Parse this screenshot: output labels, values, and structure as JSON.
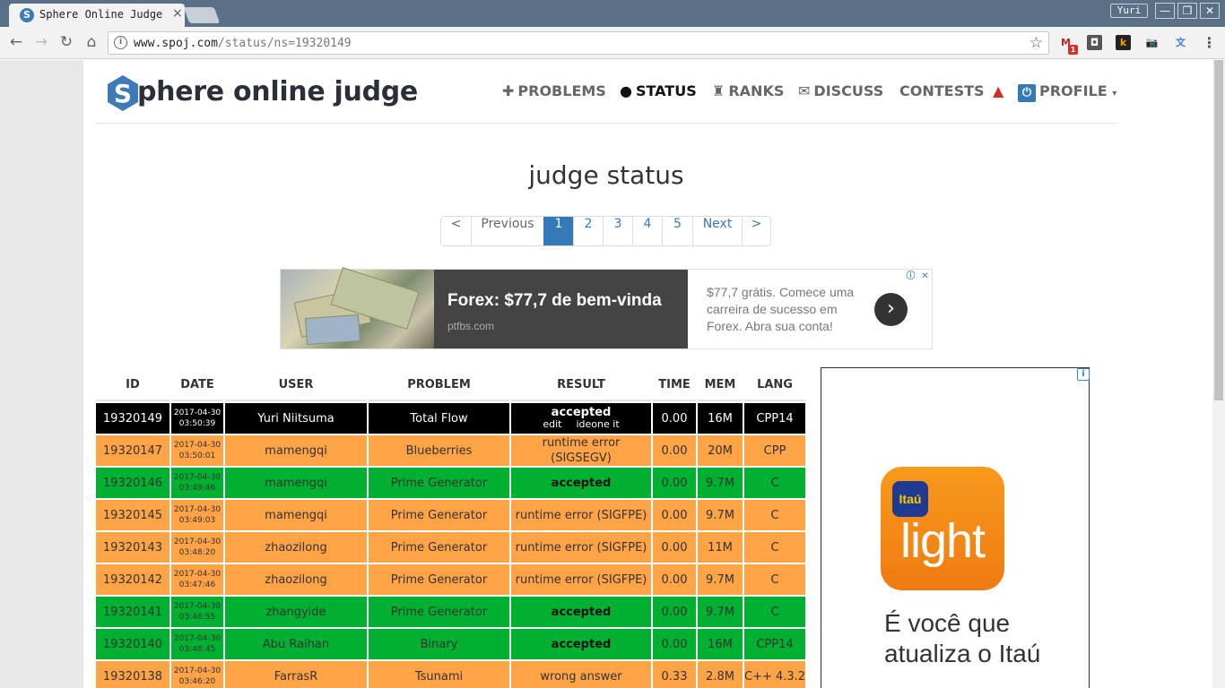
{
  "browser": {
    "tab_title": "Sphere Online Judge",
    "favicon_letter": "S",
    "tab_close": "×",
    "user_label": "Yuri",
    "url_host": "www.spoj.com",
    "url_path": "/status/ns=19320149",
    "nav": {
      "back": "←",
      "forward": "→",
      "reload": "↻",
      "home": "⌂"
    },
    "window_buttons": [
      "—",
      "❐",
      "✕"
    ],
    "extensions": [
      {
        "name": "gmail-icon",
        "glyph": "M",
        "badge": "1",
        "color": "#c5221f"
      },
      {
        "name": "pocket-icon",
        "glyph": "◘",
        "color": "#555"
      },
      {
        "name": "k-extension-icon",
        "glyph": "k",
        "color": "#f4a300"
      },
      {
        "name": "camera-icon",
        "glyph": "📷",
        "color": "#777"
      },
      {
        "name": "translate-icon",
        "glyph": "文",
        "color": "#3c78d8"
      },
      {
        "name": "menu-icon",
        "glyph": "⋮",
        "color": "#555"
      }
    ]
  },
  "site": {
    "logo_text": "phere online judge",
    "logo_letter": "S",
    "nav": {
      "problems": "PROBLEMS",
      "status": "STATUS",
      "ranks": "RANKS",
      "discuss": "DISCUSS",
      "contests": "CONTESTS",
      "profile": "PROFILE"
    }
  },
  "page_title": "judge status",
  "pagination": [
    "<",
    "Previous",
    "1",
    "2",
    "3",
    "4",
    "5",
    "Next",
    ">"
  ],
  "pagination_active": "1",
  "ad_banner": {
    "headline": "Forex: $77,7 de bem-vinda",
    "domain": "ptfbs.com",
    "body": "$77,7 grátis. Comece uma carreira de sucesso em Forex. Abra sua conta!",
    "arrow": "›",
    "info": "ⓘ",
    "close": "✕"
  },
  "table": {
    "headers": [
      "ID",
      "DATE",
      "USER",
      "PROBLEM",
      "RESULT",
      "TIME",
      "MEM",
      "LANG"
    ],
    "rows": [
      {
        "style": "black",
        "id": "19320149",
        "date": "2017-04-30",
        "time_of_day": "03:50:39",
        "user": "Yuri Niitsuma",
        "problem": "Total Flow",
        "result": "accepted",
        "result_links": [
          "edit",
          "ideone it"
        ],
        "time": "0.00",
        "mem": "16M",
        "lang": "CPP14"
      },
      {
        "style": "orange",
        "id": "19320147",
        "date": "2017-04-30",
        "time_of_day": "03:50:01",
        "user": "mamengqi",
        "problem": "Blueberries",
        "result": "runtime error",
        "result2": "(SIGSEGV)",
        "time": "0.00",
        "mem": "20M",
        "lang": "CPP"
      },
      {
        "style": "green",
        "id": "19320146",
        "date": "2017-04-30",
        "time_of_day": "03:49:46",
        "user": "mamengqi",
        "problem": "Prime Generator",
        "result": "accepted",
        "time": "0.00",
        "mem": "9.7M",
        "lang": "C"
      },
      {
        "style": "orange",
        "id": "19320145",
        "date": "2017-04-30",
        "time_of_day": "03:49:03",
        "user": "mamengqi",
        "problem": "Prime Generator",
        "result": "runtime error (SIGFPE)",
        "time": "0.00",
        "mem": "9.7M",
        "lang": "C"
      },
      {
        "style": "orange",
        "id": "19320143",
        "date": "2017-04-30",
        "time_of_day": "03:48:20",
        "user": "zhaozilong",
        "problem": "Prime Generator",
        "result": "runtime error (SIGFPE)",
        "time": "0.00",
        "mem": "11M",
        "lang": "C"
      },
      {
        "style": "orange",
        "id": "19320142",
        "date": "2017-04-30",
        "time_of_day": "03:47:46",
        "user": "zhaozilong",
        "problem": "Prime Generator",
        "result": "runtime error (SIGFPE)",
        "time": "0.00",
        "mem": "9.7M",
        "lang": "C"
      },
      {
        "style": "green",
        "id": "19320141",
        "date": "2017-04-30",
        "time_of_day": "03:46:55",
        "user": "zhangyide",
        "problem": "Prime Generator",
        "result": "accepted",
        "time": "0.00",
        "mem": "9.7M",
        "lang": "C"
      },
      {
        "style": "green",
        "id": "19320140",
        "date": "2017-04-30",
        "time_of_day": "03:46:45",
        "user": "Abu Raihan",
        "problem": "Binary",
        "result": "accepted",
        "time": "0.00",
        "mem": "16M",
        "lang": "CPP14"
      },
      {
        "style": "orange",
        "id": "19320138",
        "date": "2017-04-30",
        "time_of_day": "03:46:20",
        "user": "FarrasR",
        "problem": "Tsunami",
        "result": "wrong answer",
        "time": "0.33",
        "mem": "2.8M",
        "lang": "C++ 4.3.2"
      }
    ]
  },
  "side_ad": {
    "info": "i",
    "brand": "Itaú",
    "product": "light",
    "tagline": "É você que atualiza o Itaú"
  },
  "colors": {
    "accepted_green": "#00b030",
    "error_orange": "#ffa347",
    "own_black": "#000000",
    "link_blue": "#337ab7",
    "logo_blue": "#3d7ab8",
    "chrome_titlebar": "#5a7087"
  }
}
